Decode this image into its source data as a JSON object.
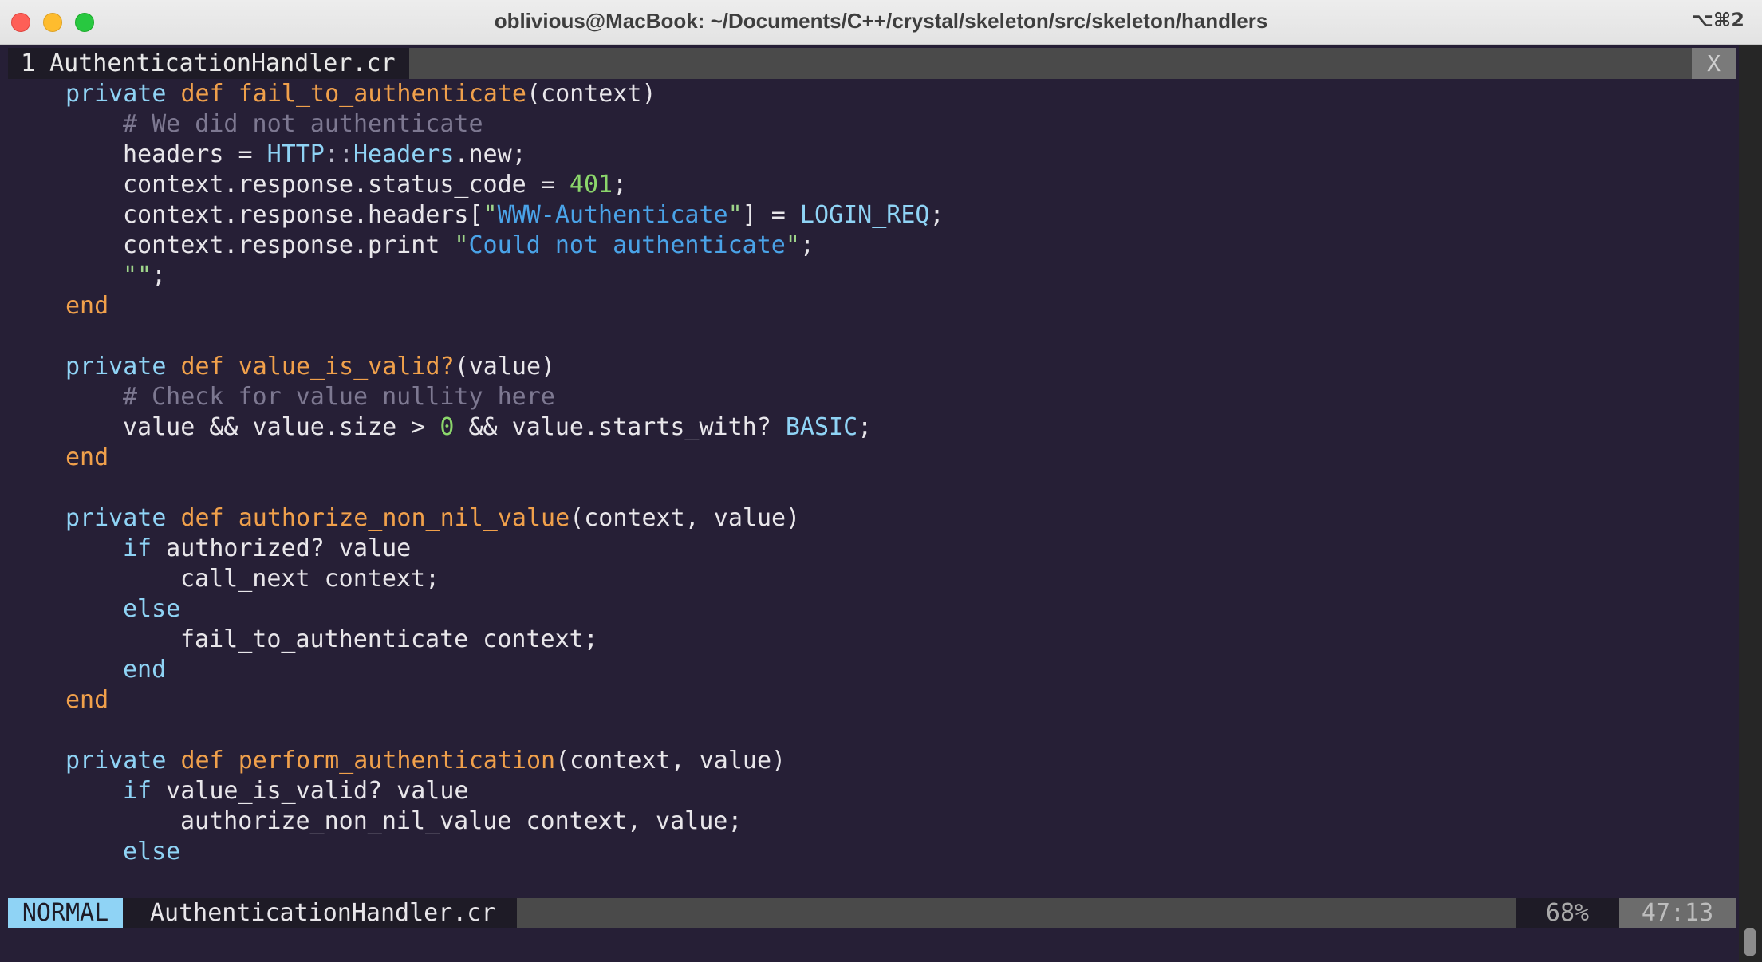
{
  "window": {
    "title": "oblivious@MacBook: ~/Documents/C++/crystal/skeleton/src/skeleton/handlers",
    "shortcut": "⌥⌘2"
  },
  "tabline": {
    "active_tab": "1 AuthenticationHandler.cr",
    "close_label": "X"
  },
  "code": {
    "l01": {
      "kw": "private",
      "def": "def",
      "fn": "fail_to_authenticate",
      "rest": "(context)"
    },
    "l02": {
      "comment": "# We did not authenticate"
    },
    "l03": {
      "a": "headers = ",
      "type": "HTTP",
      "sep": "::",
      "type2": "Headers",
      "b": ".new;"
    },
    "l04": {
      "a": "context.response.status_code = ",
      "num": "401",
      "b": ";"
    },
    "l05": {
      "a": "context.response.headers[",
      "q1": "\"",
      "str": "WWW-Authenticate",
      "q2": "\"",
      "b": "] = ",
      "const": "LOGIN_REQ",
      "c": ";"
    },
    "l06": {
      "a": "context.response.print ",
      "q1": "\"",
      "str": "Could not authenticate",
      "q2": "\"",
      "b": ";"
    },
    "l07": {
      "q": "\"\"",
      "b": ";"
    },
    "l08": {
      "end": "end"
    },
    "l10": {
      "kw": "private",
      "def": "def",
      "fn": "value_is_valid?",
      "rest": "(value)"
    },
    "l11": {
      "comment": "# Check for value nullity here"
    },
    "l12": {
      "a": "value && value.size > ",
      "num": "0",
      "b": " && value.starts_with? ",
      "const": "BASIC",
      "c": ";"
    },
    "l13": {
      "end": "end"
    },
    "l15": {
      "kw": "private",
      "def": "def",
      "fn": "authorize_non_nil_value",
      "rest": "(context, value)"
    },
    "l16": {
      "kw": "if",
      "rest": " authorized? value"
    },
    "l17": {
      "text": "call_next context;"
    },
    "l18": {
      "kw": "else"
    },
    "l19": {
      "text": "fail_to_authenticate context;"
    },
    "l20": {
      "kw": "end"
    },
    "l21": {
      "end": "end"
    },
    "l23": {
      "kw": "private",
      "def": "def",
      "fn": "perform_authentication",
      "rest": "(context, value)"
    },
    "l24": {
      "kw": "if",
      "rest": " value_is_valid? value"
    },
    "l25": {
      "text": "authorize_non_nil_value context, value;"
    },
    "l26": {
      "kw": "else"
    }
  },
  "statusline": {
    "mode": "NORMAL",
    "file": "AuthenticationHandler.cr",
    "percent": "68%",
    "position": "47:13"
  },
  "colors": {
    "background": "#261f36",
    "keyword": "#8fd3f5",
    "function": "#f0a04b",
    "comment": "#7d7891",
    "string": "#4aa3e8",
    "number": "#8bd66b",
    "mode_badge": "#8fd3f5"
  }
}
